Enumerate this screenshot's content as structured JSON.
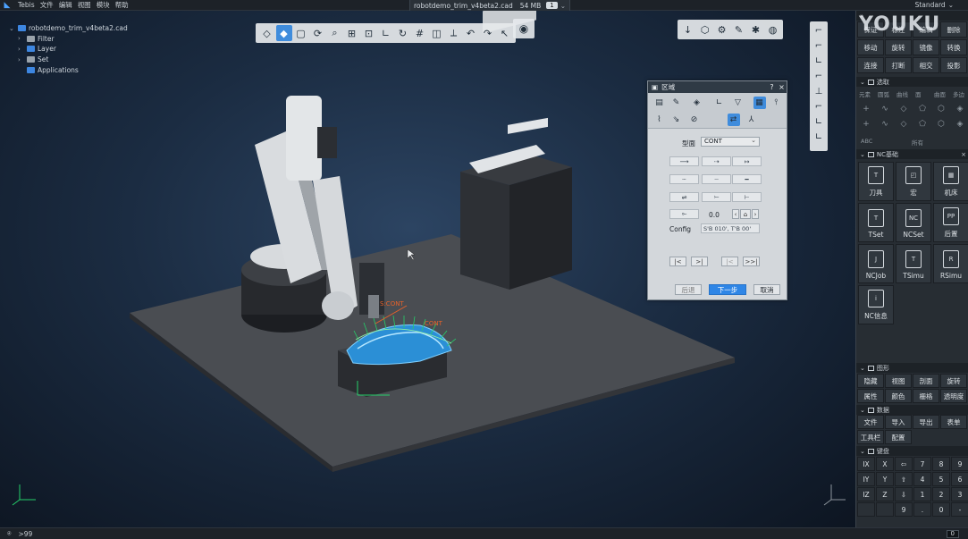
{
  "app": {
    "name": "Tebis",
    "menu": [
      "文件",
      "编辑",
      "视图",
      "模块",
      "帮助"
    ],
    "mode": "Standard"
  },
  "document_tab": {
    "filename": "robotdemo_trim_v4beta2.cad",
    "size": "54 MB",
    "window_count": "1"
  },
  "tree": {
    "root": "robotdemo_trim_v4beta2.cad",
    "items": [
      "Filter",
      "Layer",
      "Set",
      "Applications"
    ]
  },
  "icons": {
    "view_toolbar": [
      "cube-wire-icon",
      "cube-shaded-icon",
      "cube-box-icon",
      "rotate-icon",
      "zoom-icon",
      "zoom-window-icon",
      "frame-icon",
      "axis-icon",
      "spin-icon",
      "grid-icon",
      "section-icon",
      "measure-icon",
      "arrow-back-icon",
      "redo-icon",
      "cursor-icon"
    ],
    "right_toolbar": [
      "pin-icon",
      "cube-icon",
      "robot-icon",
      "pen-icon",
      "wrench-icon",
      "globe-icon"
    ]
  },
  "viewport_labels": {
    "cont_label_1": "S:CONT",
    "cont_label_2": "CONT"
  },
  "dialog": {
    "title": "区域",
    "help": "?",
    "close": "×",
    "type_label": "型面",
    "type_value": "CONT",
    "offset_value": "0.0",
    "config_label": "Config",
    "config_value": "S'B 010', T'B 00'",
    "nav_first": "|<",
    "nav_prev": ">|",
    "nav_next": "|<",
    "nav_last": ">>|",
    "back_button": "后退",
    "next_button": "下一步",
    "cancel_button": "取消"
  },
  "right_panel": {
    "watermark": "YOUKU",
    "top_rows": [
      [
        "保证",
        "标注",
        "编辑",
        "删除"
      ],
      [
        "移动",
        "旋转",
        "镜像",
        "转换"
      ],
      [
        "连接",
        "打断",
        "相交",
        "投影"
      ]
    ],
    "section_select": "选取",
    "select_labels": [
      "元素",
      "圆弧",
      "曲线",
      "面",
      "曲面",
      "多边"
    ],
    "select_label_all": "所有",
    "section_nc": "NC基础",
    "nc_tiles": [
      "刀具",
      "宏",
      "机床",
      "TSet",
      "NCSet",
      "后置",
      "NCJob",
      "TSimu",
      "RSimu",
      "NC信息"
    ],
    "section_graphics": "图形",
    "graphics_rows": [
      [
        "隐藏",
        "视图",
        "剖面",
        "旋转"
      ],
      [
        "属性",
        "颜色",
        "栅格",
        "透明度"
      ]
    ],
    "section_data": "数据",
    "data_rows": [
      [
        "文件",
        "导入",
        "导出",
        "表单"
      ],
      [
        "工具栏",
        "配置"
      ]
    ],
    "section_keyboard": "键盘",
    "keyboard_rows": [
      [
        "IX",
        "X",
        "⇦",
        "7",
        "8",
        "9"
      ],
      [
        "IY",
        "Y",
        "⇧",
        "4",
        "5",
        "6"
      ],
      [
        "IZ",
        "Z",
        "⇩",
        "1",
        "2",
        "3"
      ],
      [
        "",
        "",
        "9",
        ".",
        "0",
        "-"
      ]
    ]
  },
  "statusbar": {
    "count": ">99",
    "badge": "0"
  }
}
